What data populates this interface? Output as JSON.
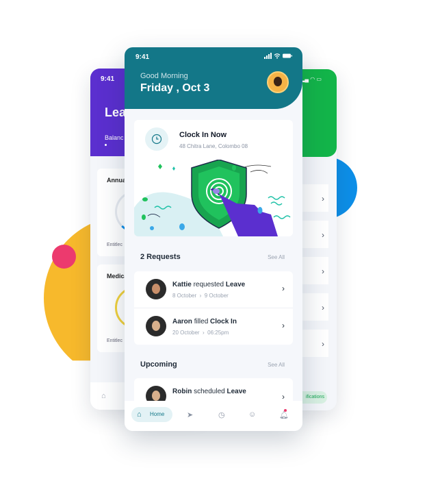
{
  "status": {
    "time": "9:41"
  },
  "header": {
    "greeting": "Good Morning",
    "date": "Friday , Oct 3"
  },
  "clock_in": {
    "title": "Clock In Now",
    "location": "48 Chitra Lane, Colombo 08"
  },
  "requests": {
    "title": "2 Requests",
    "see_all": "See All",
    "items": [
      {
        "name": "Kattie",
        "action": "requested",
        "object": "Leave",
        "sub_a": "8 October",
        "sub_b": "9 October"
      },
      {
        "name": "Aaron",
        "action": "filled",
        "object": "Clock In",
        "sub_a": "20 October",
        "sub_b": "06:25pm"
      }
    ]
  },
  "upcoming": {
    "title": "Upcoming",
    "see_all": "See All",
    "items": [
      {
        "name": "Robin",
        "action": "scheduled",
        "object": "Leave"
      }
    ]
  },
  "nav": {
    "home": "Home"
  },
  "left_phone": {
    "time": "9:41",
    "title": "Lea",
    "balance": "Balanc",
    "card1_label": "Annua",
    "card1_sub": "Entitlec",
    "card2_label": "Medica",
    "card2_sub": "Entitlec"
  },
  "right_phone": {
    "pill": "ifications"
  },
  "colors": {
    "teal": "#137788",
    "purple": "#5b2fcf",
    "green": "#13b54a",
    "yellow": "#f7b92c",
    "pink": "#ec3a6e",
    "blue": "#0d8fe8"
  }
}
